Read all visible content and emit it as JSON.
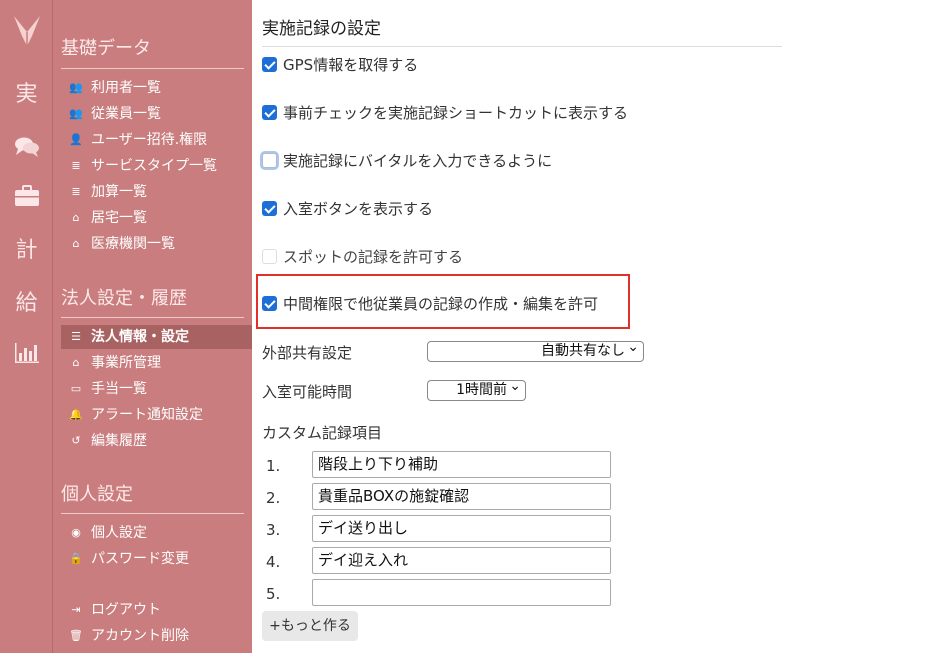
{
  "rail": {
    "items": [
      {
        "icon": "logo-icon"
      },
      {
        "text": "実"
      },
      {
        "icon": "chat-icon"
      },
      {
        "icon": "briefcase-icon"
      },
      {
        "text": "計"
      },
      {
        "text": "給"
      },
      {
        "icon": "bar-chart-icon"
      }
    ]
  },
  "sidebar": {
    "sections": [
      {
        "title": "基礎データ",
        "items": [
          {
            "label": "利用者一覧",
            "icon": "users-icon"
          },
          {
            "label": "従業員一覧",
            "icon": "users-icon"
          },
          {
            "label": "ユーザー招待.権限",
            "icon": "user-plus-icon"
          },
          {
            "label": "サービスタイプ一覧",
            "icon": "database-icon"
          },
          {
            "label": "加算一覧",
            "icon": "database-icon"
          },
          {
            "label": "居宅一覧",
            "icon": "building-icon"
          },
          {
            "label": "医療機関一覧",
            "icon": "building-icon"
          }
        ]
      },
      {
        "title": "法人設定・履歴",
        "items": [
          {
            "label": "法人情報・設定",
            "icon": "sliders-icon",
            "active": true
          },
          {
            "label": "事業所管理",
            "icon": "home-icon"
          },
          {
            "label": "手当一覧",
            "icon": "money-icon"
          },
          {
            "label": "アラート通知設定",
            "icon": "bell-icon"
          },
          {
            "label": "編集履歴",
            "icon": "history-icon"
          }
        ]
      },
      {
        "title": "個人設定",
        "items": [
          {
            "label": "個人設定",
            "icon": "user-circle-icon"
          },
          {
            "label": "パスワード変更",
            "icon": "lock-icon"
          }
        ]
      }
    ],
    "footer": [
      {
        "label": "ログアウト",
        "icon": "logout-icon"
      },
      {
        "label": "アカウント削除",
        "icon": "trash-icon"
      }
    ]
  },
  "main": {
    "title": "実施記録の設定",
    "checkboxes": [
      {
        "label": "GPS情報を取得する",
        "checked": true
      },
      {
        "label": "事前チェックを実施記録ショートカットに表示する",
        "checked": true
      },
      {
        "label": "実施記録にバイタルを入力できるように",
        "checked": false
      },
      {
        "label": "入室ボタンを表示する",
        "checked": true
      },
      {
        "label": "スポットの記録を許可する",
        "checked": false
      },
      {
        "label": "中間権限で他従業員の記録の作成・編集を許可",
        "checked": true
      }
    ],
    "external_share": {
      "label": "外部共有設定",
      "value": "自動共有なし"
    },
    "entry_time": {
      "label": "入室可能時間",
      "value": "1時間前"
    },
    "custom": {
      "label": "カスタム記録項目",
      "items": [
        {
          "num": "1.",
          "value": "階段上り下り補助"
        },
        {
          "num": "2.",
          "value": "貴重品BOXの施錠確認"
        },
        {
          "num": "3.",
          "value": "デイ送り出し"
        },
        {
          "num": "4.",
          "value": "デイ迎え入れ"
        },
        {
          "num": "5.",
          "value": ""
        }
      ]
    },
    "more_button": "+もっと作る"
  },
  "colors": {
    "sidebar_bg": "#c97d7e",
    "active_bg": "#a86262",
    "checkbox_on": "#1d6fd6",
    "highlight": "#e0302a"
  }
}
